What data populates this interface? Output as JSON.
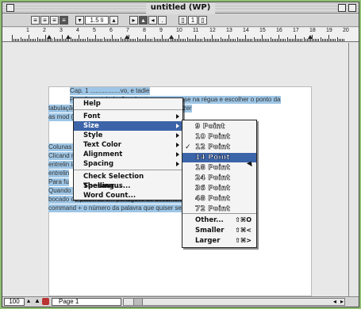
{
  "window": {
    "title": "untitled (WP)"
  },
  "toolbar": {
    "line_spacing": "1.5 li",
    "column_count": "1"
  },
  "ruler": {
    "numbers": [
      "1",
      "2",
      "3",
      "4",
      "5",
      "6",
      "7",
      "8",
      "9",
      "10",
      "11",
      "12",
      "13",
      "14",
      "15",
      "16",
      "17",
      "18",
      "19",
      "20"
    ]
  },
  "document": {
    "lines": [
      "Cap. 1 .................vo, e tadie",
      "Para fazer tabulações, basta usar o mouse na régua e escolher o ponto da",
      "tabulação                               duas vezes na seta de tabulação e fazer",
      "as mod                                  (...)",
      "Colunas                                                        as ao documento.",
      "Clicand                                                        mo vale para a",
      "entrelin                                                       ia, aumenta a",
      "entrelin",
      "Para fu",
      "Quando                                                         que você incluir um",
      "bocado de palavras em português ao documento. Para ela escolher",
      "command + o número da palavra que quiser                      ser com o mouse."
    ]
  },
  "context_menu": {
    "help": "Help",
    "items": [
      {
        "label": "Font",
        "submenu": true
      },
      {
        "label": "Size",
        "submenu": true,
        "highlighted": true
      },
      {
        "label": "Style",
        "submenu": true
      },
      {
        "label": "Text Color",
        "submenu": true
      },
      {
        "label": "Alignment",
        "submenu": true
      },
      {
        "label": "Spacing",
        "submenu": true
      }
    ],
    "actions": [
      "Check Selection Spelling...",
      "Thesaurus...",
      "Word Count..."
    ]
  },
  "size_menu": {
    "points": [
      {
        "label": "9 Point",
        "checked": false
      },
      {
        "label": "10 Point",
        "checked": false
      },
      {
        "label": "12 Point",
        "checked": true
      },
      {
        "label": "14 Point",
        "highlighted": true
      },
      {
        "label": "18 Point",
        "checked": false
      },
      {
        "label": "24 Point",
        "checked": false
      },
      {
        "label": "36 Point",
        "checked": false
      },
      {
        "label": "48 Point",
        "checked": false
      },
      {
        "label": "72 Point",
        "checked": false
      }
    ],
    "checkmark": "✓",
    "other": {
      "label": "Other...",
      "shortcut": "⇧⌘O"
    },
    "smaller": {
      "label": "Smaller",
      "shortcut": "⇧⌘<"
    },
    "larger": {
      "label": "Larger",
      "shortcut": "⇧⌘>"
    }
  },
  "status": {
    "zoom": "100",
    "page": "Page 1"
  },
  "colors": {
    "selection": "#9ec6e6",
    "menu_highlight": "#3c64a8",
    "background": "#8fbf72"
  }
}
